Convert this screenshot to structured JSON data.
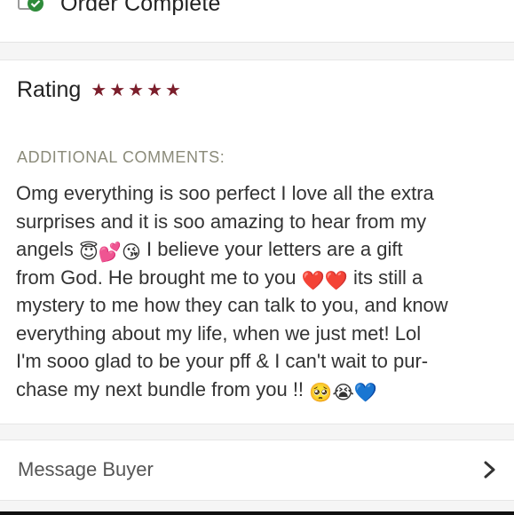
{
  "order": {
    "status_title": "Order Complete"
  },
  "review": {
    "rating_label": "Rating",
    "rating_stars": 5,
    "comments_heading": "ADDITIONAL COMMENTS:",
    "comment_lines": [
      [
        "Omg everything is soo perfect I love all the extra"
      ],
      [
        "surprises and it is soo amazing to hear from my"
      ],
      [
        "angels ",
        "😇",
        "💕",
        "😘",
        " I believe your letters are a gift"
      ],
      [
        "from God. He brought me to you ",
        "❤️",
        "❤️",
        " its still a"
      ],
      [
        "mystery to me how they can talk to you, and know"
      ],
      [
        "everything about my life, when we just met! Lol"
      ],
      [
        "I'm sooo glad to be your pff & I can't wait to pur-"
      ],
      [
        "chase my next bundle from you !! ",
        "🥺",
        "😭",
        "💙"
      ]
    ]
  },
  "actions": {
    "message_buyer_label": "Message Buyer"
  },
  "colors": {
    "star": "#7b1e2b",
    "heading_muted": "#8b8b7a",
    "check_green": "#2e8b3a"
  },
  "icons": {
    "order": "receipt-check-icon",
    "star": "star-icon",
    "chevron": "chevron-right-icon"
  }
}
